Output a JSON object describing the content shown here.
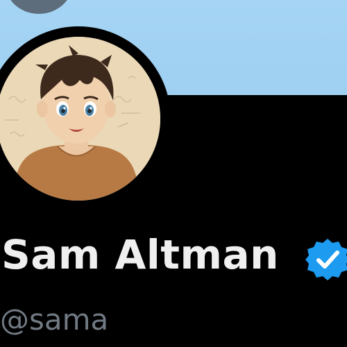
{
  "profile": {
    "display_name": "Sam Altman",
    "handle": "@sama",
    "verified": true,
    "avatar_icon": "anime-style-portrait-avatar",
    "banner_color": "#a5d4f4",
    "badge_color": "#1d9bf0"
  },
  "header": {
    "back_icon": "back-arrow-button"
  }
}
